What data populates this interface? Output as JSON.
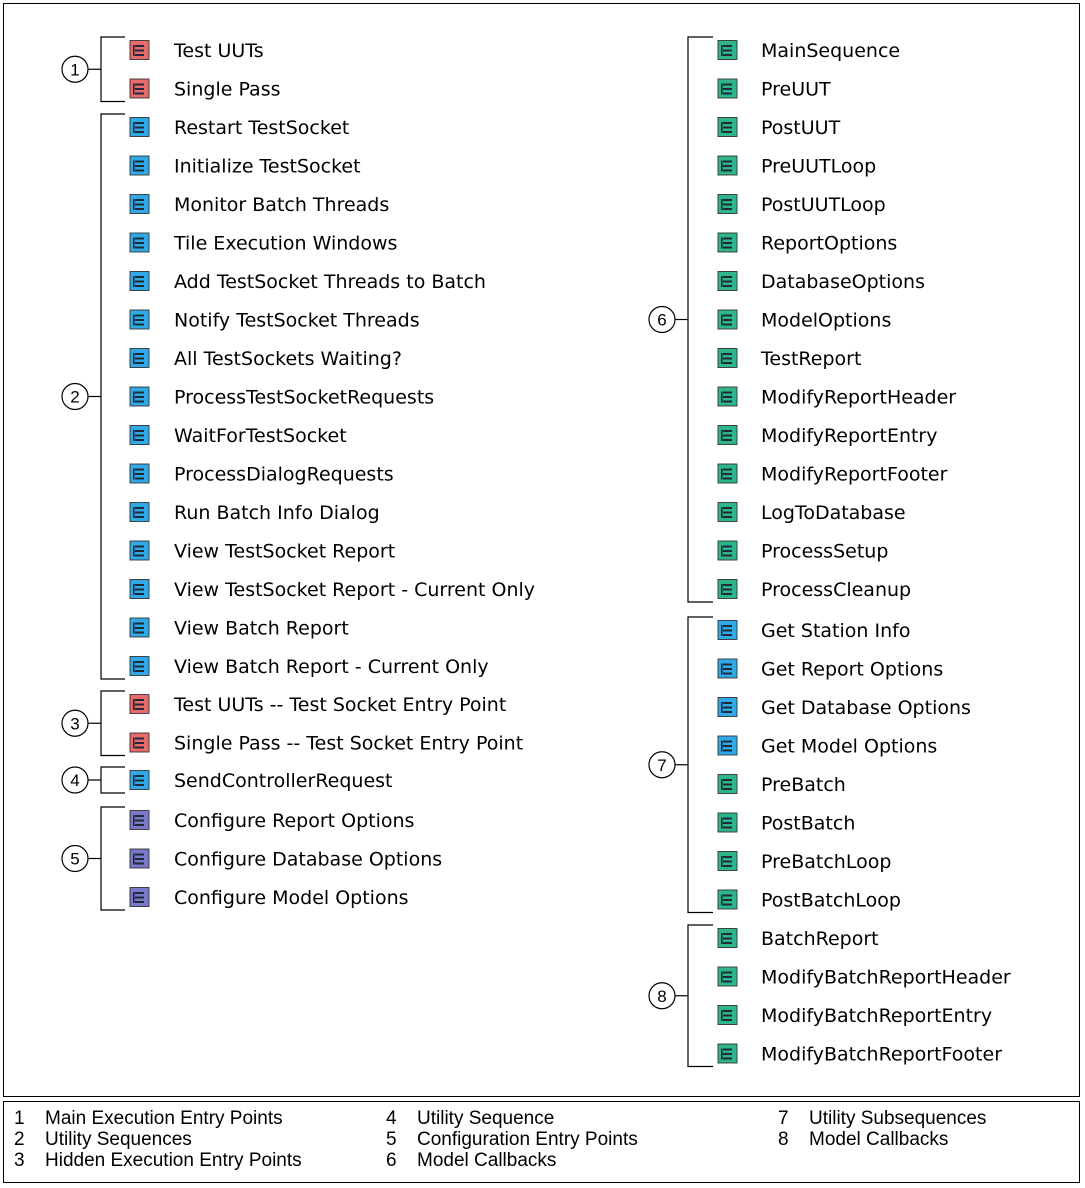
{
  "colors": {
    "red_icon": "#e86a6a",
    "blue_icon": "#31a9e6",
    "purple_icon": "#7a78c8",
    "green_icon": "#2fb58a",
    "line": "#000000"
  },
  "groups": [
    {
      "number": "1",
      "items": [
        {
          "label": "Test UUTs",
          "icon": "red-sequence-icon"
        },
        {
          "label": "Single Pass",
          "icon": "red-sequence-icon"
        }
      ]
    },
    {
      "number": "2",
      "items": [
        {
          "label": "Restart TestSocket",
          "icon": "blue-sequence-icon"
        },
        {
          "label": "Initialize TestSocket",
          "icon": "blue-sequence-icon"
        },
        {
          "label": "Monitor Batch Threads",
          "icon": "blue-sequence-icon"
        },
        {
          "label": "Tile Execution Windows",
          "icon": "blue-sequence-icon"
        },
        {
          "label": "Add TestSocket Threads to Batch",
          "icon": "blue-sequence-icon"
        },
        {
          "label": "Notify TestSocket Threads",
          "icon": "blue-sequence-icon"
        },
        {
          "label": "All TestSockets Waiting?",
          "icon": "blue-sequence-icon"
        },
        {
          "label": "ProcessTestSocketRequests",
          "icon": "blue-sequence-icon"
        },
        {
          "label": "WaitForTestSocket",
          "icon": "blue-sequence-icon"
        },
        {
          "label": "ProcessDialogRequests",
          "icon": "blue-sequence-icon"
        },
        {
          "label": "Run Batch Info Dialog",
          "icon": "blue-sequence-icon"
        },
        {
          "label": "View TestSocket Report",
          "icon": "blue-sequence-icon"
        },
        {
          "label": "View TestSocket Report - Current Only",
          "icon": "blue-sequence-icon"
        },
        {
          "label": "View Batch Report",
          "icon": "blue-sequence-icon"
        },
        {
          "label": "View Batch Report - Current Only",
          "icon": "blue-sequence-icon"
        }
      ]
    },
    {
      "number": "3",
      "items": [
        {
          "label": "Test UUTs -- Test Socket Entry Point",
          "icon": "red-sequence-icon"
        },
        {
          "label": "Single Pass -- Test Socket Entry Point",
          "icon": "red-sequence-icon"
        }
      ]
    },
    {
      "number": "4",
      "items": [
        {
          "label": "SendControllerRequest",
          "icon": "blue-sequence-icon"
        }
      ]
    },
    {
      "number": "5",
      "items": [
        {
          "label": "Configure Report Options",
          "icon": "purple-sequence-icon"
        },
        {
          "label": "Configure Database Options",
          "icon": "purple-sequence-icon"
        },
        {
          "label": "Configure Model Options",
          "icon": "purple-sequence-icon"
        }
      ]
    },
    {
      "number": "6",
      "items": [
        {
          "label": "MainSequence",
          "icon": "green-sequence-icon"
        },
        {
          "label": "PreUUT",
          "icon": "green-sequence-icon"
        },
        {
          "label": "PostUUT",
          "icon": "green-sequence-icon"
        },
        {
          "label": "PreUUTLoop",
          "icon": "green-sequence-icon"
        },
        {
          "label": "PostUUTLoop",
          "icon": "green-sequence-icon"
        },
        {
          "label": "ReportOptions",
          "icon": "green-sequence-icon"
        },
        {
          "label": "DatabaseOptions",
          "icon": "green-sequence-icon"
        },
        {
          "label": "ModelOptions",
          "icon": "green-sequence-icon"
        },
        {
          "label": "TestReport",
          "icon": "green-sequence-icon"
        },
        {
          "label": "ModifyReportHeader",
          "icon": "green-sequence-icon"
        },
        {
          "label": "ModifyReportEntry",
          "icon": "green-sequence-icon"
        },
        {
          "label": "ModifyReportFooter",
          "icon": "green-sequence-icon"
        },
        {
          "label": "LogToDatabase",
          "icon": "green-sequence-icon"
        },
        {
          "label": "ProcessSetup",
          "icon": "green-sequence-icon"
        },
        {
          "label": "ProcessCleanup",
          "icon": "green-sequence-icon"
        }
      ]
    },
    {
      "number": "7",
      "items": [
        {
          "label": "Get Station Info",
          "icon": "blue-sequence-icon"
        },
        {
          "label": "Get Report Options",
          "icon": "blue-sequence-icon"
        },
        {
          "label": "Get Database Options",
          "icon": "blue-sequence-icon"
        },
        {
          "label": "Get Model Options",
          "icon": "blue-sequence-icon"
        },
        {
          "label": "PreBatch",
          "icon": "green-sequence-icon"
        },
        {
          "label": "PostBatch",
          "icon": "green-sequence-icon"
        },
        {
          "label": "PreBatchLoop",
          "icon": "green-sequence-icon"
        },
        {
          "label": "PostBatchLoop",
          "icon": "green-sequence-icon"
        }
      ]
    },
    {
      "number": "8",
      "items": [
        {
          "label": "BatchReport",
          "icon": "green-sequence-icon"
        },
        {
          "label": "ModifyBatchReportHeader",
          "icon": "green-sequence-icon"
        },
        {
          "label": "ModifyBatchReportEntry",
          "icon": "green-sequence-icon"
        },
        {
          "label": "ModifyBatchReportFooter",
          "icon": "green-sequence-icon"
        }
      ]
    }
  ],
  "legend": [
    {
      "number": "1",
      "label": "Main Execution Entry Points"
    },
    {
      "number": "2",
      "label": "Utility Sequences"
    },
    {
      "number": "3",
      "label": "Hidden Execution Entry Points"
    },
    {
      "number": "4",
      "label": "Utility Sequence"
    },
    {
      "number": "5",
      "label": "Configuration Entry Points"
    },
    {
      "number": "6",
      "label": "Model Callbacks"
    },
    {
      "number": "7",
      "label": "Utility Subsequences"
    },
    {
      "number": "8",
      "label": "Model Callbacks"
    }
  ]
}
